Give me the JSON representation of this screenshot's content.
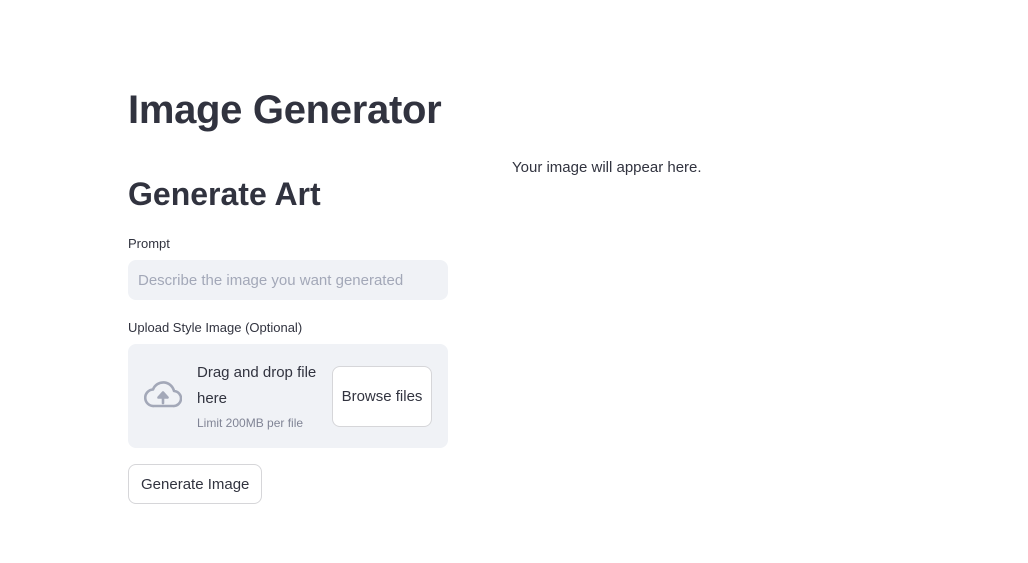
{
  "app": {
    "title": "Image Generator"
  },
  "form": {
    "section_title": "Generate Art",
    "prompt": {
      "label": "Prompt",
      "value": "",
      "placeholder": "Describe the image you want generated"
    },
    "upload": {
      "label": "Upload Style Image (Optional)",
      "drop_text": "Drag and drop file here",
      "limit_text": "Limit 200MB per file",
      "browse_label": "Browse files",
      "icon": "cloud-upload-icon"
    },
    "generate_label": "Generate Image"
  },
  "output": {
    "placeholder": "Your image will appear here."
  },
  "colors": {
    "text": "#31333f",
    "input_bg": "#f0f2f6",
    "muted": "#808495",
    "icon": "#a3a8b8",
    "border": "#d6d6d9"
  }
}
